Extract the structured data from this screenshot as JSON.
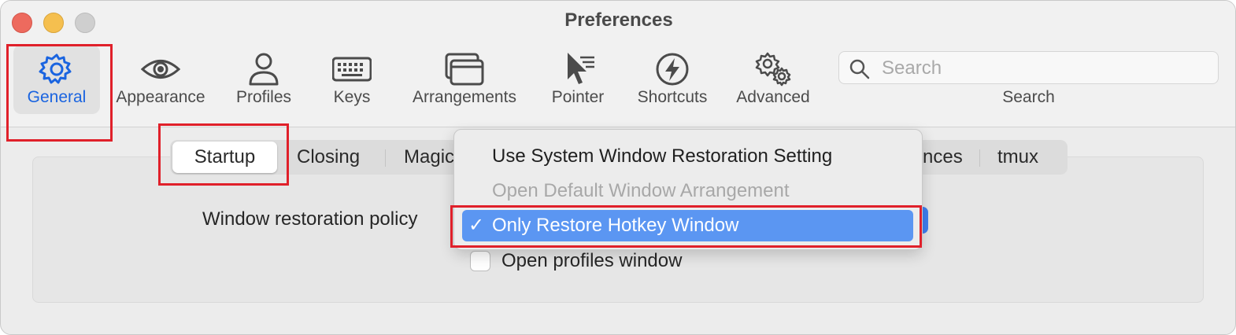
{
  "window": {
    "title": "Preferences"
  },
  "toolbar": {
    "items": [
      {
        "label": "General",
        "icon": "gear-icon"
      },
      {
        "label": "Appearance",
        "icon": "eye-icon"
      },
      {
        "label": "Profiles",
        "icon": "person-icon"
      },
      {
        "label": "Keys",
        "icon": "keyboard-icon"
      },
      {
        "label": "Arrangements",
        "icon": "windows-icon"
      },
      {
        "label": "Pointer",
        "icon": "pointer-icon"
      },
      {
        "label": "Shortcuts",
        "icon": "bolt-icon"
      },
      {
        "label": "Advanced",
        "icon": "gears-icon"
      }
    ],
    "search": {
      "placeholder": "Search",
      "label": "Search"
    }
  },
  "tabs": [
    {
      "label": "Startup",
      "active": true
    },
    {
      "label": "Closing"
    },
    {
      "label": "Magic"
    },
    {
      "label": "nces"
    },
    {
      "label": "tmux"
    }
  ],
  "startup": {
    "policy_label": "Window restoration policy",
    "checkbox_label": "Open profiles window",
    "checkbox_checked": false
  },
  "menu": {
    "items": [
      {
        "label": "Use System Window Restoration Setting",
        "state": "normal"
      },
      {
        "label": "Open Default Window Arrangement",
        "state": "disabled"
      },
      {
        "label": "Only Restore Hotkey Window",
        "state": "selected",
        "check": "✓"
      }
    ]
  },
  "colors": {
    "accent": "#1a64e0",
    "menu_highlight": "#5b96f2",
    "annotation": "#e0202a"
  }
}
